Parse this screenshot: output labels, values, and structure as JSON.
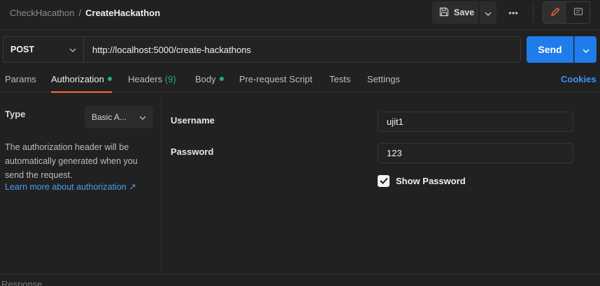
{
  "breadcrumb": {
    "collection": "CheckHacathon",
    "separator": "/",
    "request": "CreateHackathon"
  },
  "toolbar": {
    "save_label": "Save",
    "more_glyph": "•••"
  },
  "request": {
    "method": "POST",
    "url": "http://localhost:5000/create-hackathons"
  },
  "send": {
    "label": "Send"
  },
  "tabs": [
    {
      "label": "Params"
    },
    {
      "label": "Authorization"
    },
    {
      "label": "Headers",
      "count": "(9)"
    },
    {
      "label": "Body"
    },
    {
      "label": "Pre-request Script"
    },
    {
      "label": "Tests"
    },
    {
      "label": "Settings"
    }
  ],
  "cookies_label": "Cookies",
  "auth": {
    "type_label": "Type",
    "type_value": "Basic A...",
    "description": "The authorization header will be automatically generated when you send the request.",
    "learn_more": "Learn more about authorization ↗",
    "username_label": "Username",
    "username_value": "ujit1",
    "password_label": "Password",
    "password_value": "123",
    "show_password_label": "Show Password",
    "show_password_checked": true
  },
  "response": {
    "label": "Response"
  },
  "colors": {
    "accent_send": "#1f7cea",
    "active_tab_underline": "#ff6c37",
    "status_dot": "#1fb36b",
    "link": "#4d9df0"
  }
}
